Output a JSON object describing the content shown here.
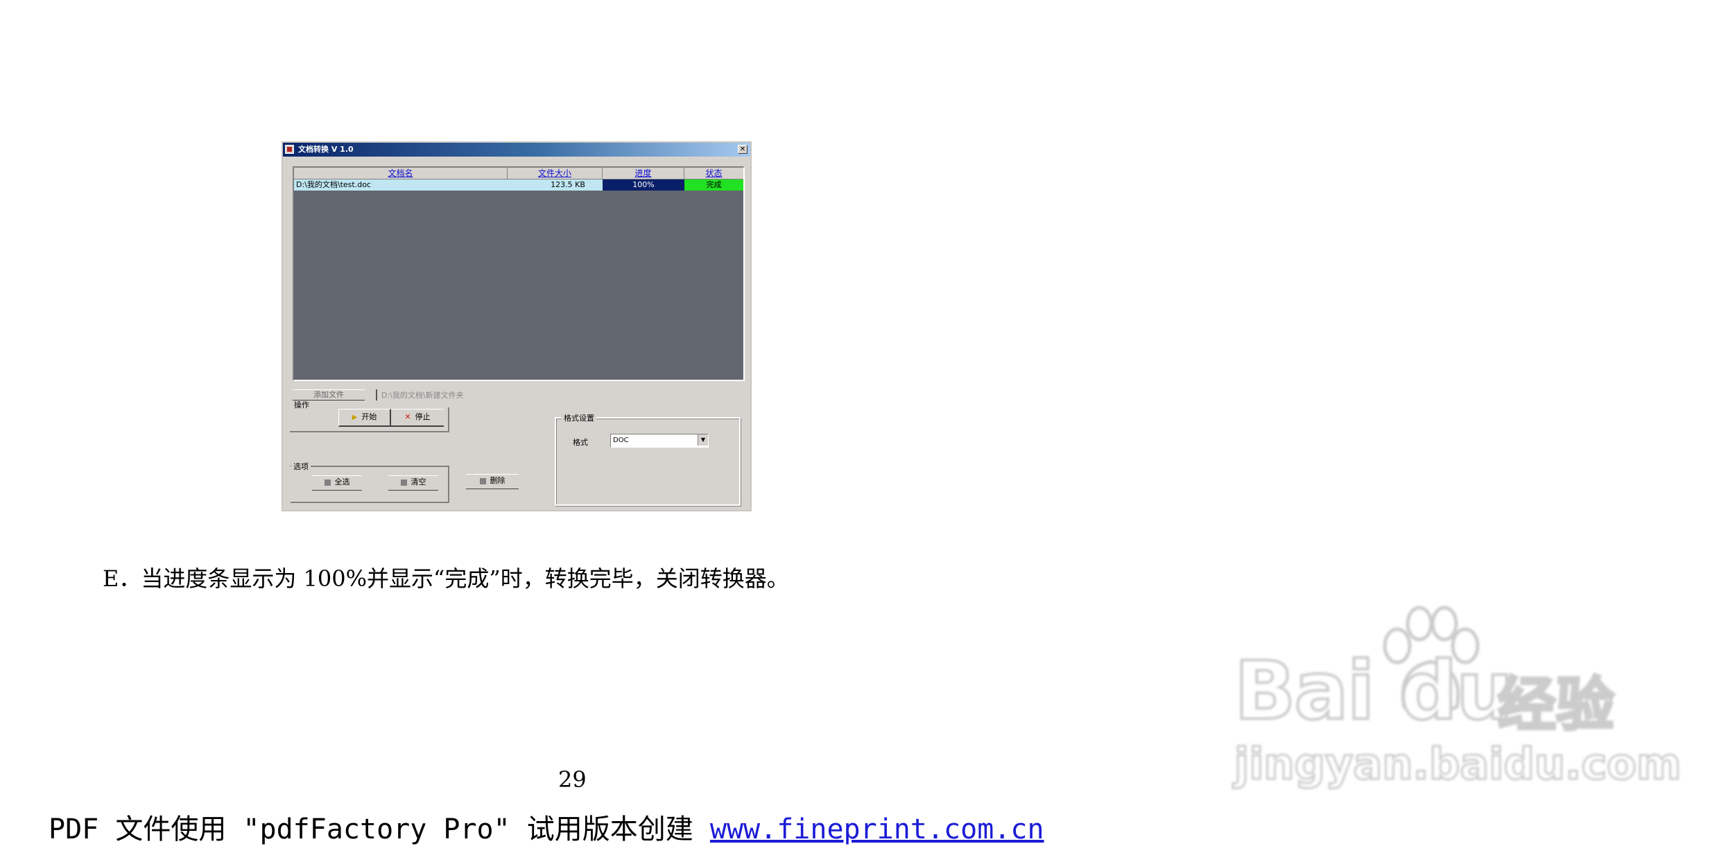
{
  "window": {
    "title": "文档转换 V 1.0",
    "close_glyph": "✕",
    "columns": [
      "文档名",
      "文件大小",
      "进度",
      "状态"
    ],
    "rows": [
      {
        "file": "D:\\我的文档\\test.doc",
        "size": "123.5 KB",
        "progress": "100%",
        "status": "完成"
      }
    ],
    "browse_button": "添加文件",
    "path_label": "D:\\我的文档\\新建文件夹",
    "operation_group": {
      "title": "操作",
      "start_button": "开始",
      "stop_button": "停止"
    },
    "options_group": {
      "title": "选项",
      "items": [
        "全选",
        "清空",
        "删除"
      ]
    },
    "format_group": {
      "title": "格式设置",
      "label": "格式",
      "selected": "DOC"
    }
  },
  "paragraph": "E．当进度条显示为 100%并显示“完成”时，转换完毕，关闭转换器。",
  "page_number": "29",
  "footer": {
    "text": "PDF 文件使用 \"pdfFactory Pro\" 试用版本创建 ",
    "link": "www.fineprint.com.cn"
  },
  "watermark": {
    "brand": "Bai du",
    "cn": "经验",
    "url": "jingyan.baidu.com"
  }
}
